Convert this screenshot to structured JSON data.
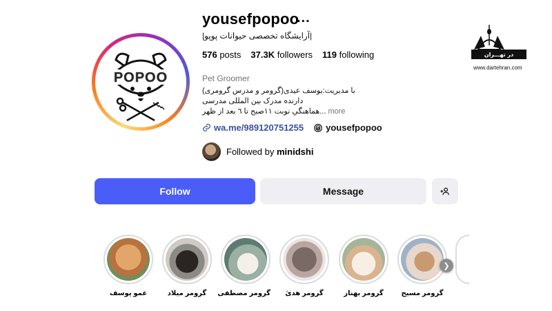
{
  "profile": {
    "username": "yousefpopoo",
    "more_icon": "...",
    "full_name": "|آرایشگاه تخصصی حیوانات پوپو|",
    "stats": {
      "posts_value": "576",
      "posts_label": "posts",
      "followers_value": "37.3K",
      "followers_label": "followers",
      "following_value": "119",
      "following_label": "following"
    },
    "category": "Pet Groomer",
    "bio": {
      "line1": "با مدیریت:یوسف عیدی(گرومر و مدرس گرومری)",
      "line2": "دارنده مدرک بین المللی مدرسی",
      "line3": "...هماهنگي نوبت ١١صبح تا ٦ بعد از ظهر",
      "more": "more"
    },
    "links": {
      "whatsapp": "wa.me/989120751255",
      "threads": "yousefpopoo"
    },
    "followed_by": {
      "prefix": "Followed by",
      "user": "minidshi"
    },
    "avatar_logo_text": "POPOO"
  },
  "actions": {
    "follow": "Follow",
    "message": "Message",
    "add_user_icon": "add-user-icon"
  },
  "highlights": [
    {
      "label": "عمو یوسف",
      "color": "#c9854d"
    },
    {
      "label": "گرومر میلاد",
      "color": "#3a3230"
    },
    {
      "label": "گرومر مصطفی",
      "color": "#d8d1c4"
    },
    {
      "label": "گرومر هدیٰ",
      "color": "#6e5f5a"
    },
    {
      "label": "گرومر بهناز",
      "color": "#e9d7c7"
    },
    {
      "label": "گرومر مسیح",
      "color": "#c49c7a"
    }
  ],
  "watermark": {
    "title": "در تهـــران",
    "url": "www.dartehran.com"
  },
  "colors": {
    "follow_button": "#4a5df9",
    "secondary_button": "#efeff3",
    "link": "#3a4fa8"
  }
}
